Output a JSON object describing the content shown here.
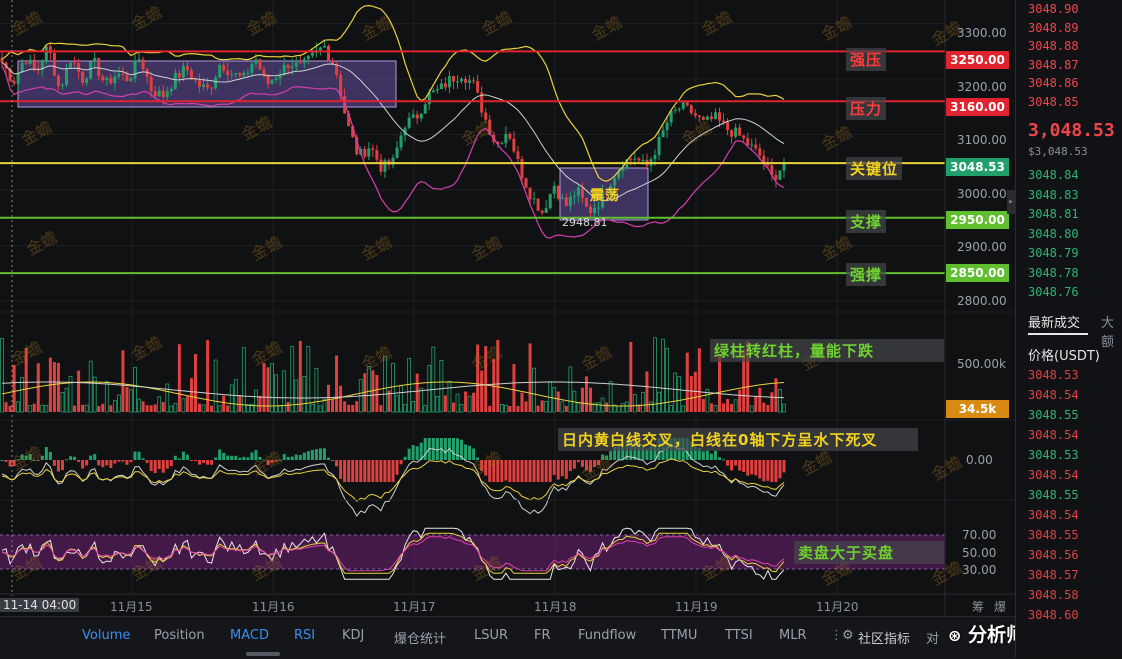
{
  "watermark": "金蟾",
  "annotations": {
    "strong_resistance": "强压",
    "resistance": "压力",
    "key_level": "关键位",
    "support": "支撑",
    "strong_support": "强撑",
    "range": "震荡",
    "range_low_value": "2948.81",
    "volume_note": "绿柱转红柱，量能下跌",
    "macd_note": "日内黄白线交叉，白线在0轴下方呈水下死叉",
    "rsi_note": "卖盘大于买盘"
  },
  "price_levels": [
    {
      "label": "3250.00",
      "color": "#e0242f"
    },
    {
      "label": "3160.00",
      "color": "#e0242f"
    },
    {
      "label": "3048.53",
      "color": "#22a06b"
    },
    {
      "label": "2950.00",
      "color": "#5fbf2f"
    },
    {
      "label": "2850.00",
      "color": "#5fbf2f"
    }
  ],
  "chart_data": {
    "type": "candlestick",
    "y_ticks": [
      "3300.00",
      "3200.00",
      "3100.00",
      "3000.00",
      "2900.00",
      "2800.00"
    ],
    "ylim": [
      2780,
      3330
    ],
    "x_labels": [
      "11-14 04:00",
      "11月15",
      "11月16",
      "11月17",
      "11月18",
      "11月19",
      "11月20"
    ],
    "close_path": [
      3230,
      3195,
      3240,
      3210,
      3260,
      3180,
      3240,
      3200,
      3230,
      3190,
      3210,
      3200,
      3240,
      3180,
      3170,
      3200,
      3220,
      3190,
      3180,
      3230,
      3210,
      3200,
      3240,
      3190,
      3210,
      3230,
      3220,
      3240,
      3260,
      3220,
      3120,
      3060,
      3080,
      3040,
      3050,
      3120,
      3130,
      3170,
      3180,
      3200,
      3210,
      3190,
      3130,
      3080,
      3110,
      3040,
      2990,
      2960,
      3010,
      2970,
      3000,
      2960,
      2980,
      3020,
      3050,
      3060,
      3040,
      3080,
      3130,
      3150,
      3140,
      3120,
      3130,
      3110,
      3100,
      3080,
      3060,
      3020,
      3048
    ],
    "volume_current": "34.5k",
    "volume_tick": "500.00k",
    "macd_tick": "0.00",
    "rsi_ticks": [
      "70.00",
      "50.00",
      "30.00"
    ]
  },
  "order_book": {
    "asks": [
      "3048.90",
      "3048.89",
      "3048.88",
      "3048.87",
      "3048.86",
      "3048.85"
    ],
    "last_price": "3,048.53",
    "last_price_usd": "$3,048.53",
    "bids": [
      "3048.84",
      "3048.83",
      "3048.81",
      "3048.80",
      "3048.79",
      "3048.78",
      "3048.76"
    ],
    "tab_trades": "最新成交",
    "tab_large": "大额",
    "price_header": "价格(USDT)",
    "trades": [
      {
        "p": "3048.53",
        "c": "#e04040"
      },
      {
        "p": "3048.54",
        "c": "#e04040"
      },
      {
        "p": "3048.55",
        "c": "#2bb673"
      },
      {
        "p": "3048.54",
        "c": "#e04040"
      },
      {
        "p": "3048.53",
        "c": "#2bb673"
      },
      {
        "p": "3048.54",
        "c": "#e04040"
      },
      {
        "p": "3048.55",
        "c": "#2bb673"
      },
      {
        "p": "3048.54",
        "c": "#e04040"
      },
      {
        "p": "3048.55",
        "c": "#e04040"
      },
      {
        "p": "3048.56",
        "c": "#e04040"
      },
      {
        "p": "3048.57",
        "c": "#e04040"
      },
      {
        "p": "3048.58",
        "c": "#e04040"
      },
      {
        "p": "3048.60",
        "c": "#e04040"
      }
    ]
  },
  "indicator_tabs": [
    "Volume",
    "Position",
    "MACD",
    "RSI",
    "KDJ",
    "爆仓统计",
    "LSUR",
    "FR",
    "Fundflow",
    "TTMU",
    "TTSI",
    "MLR"
  ],
  "community_label": "社区指标",
  "more_label": "对",
  "right_header": [
    "筹",
    "爆"
  ],
  "credit": "分析师老罗"
}
